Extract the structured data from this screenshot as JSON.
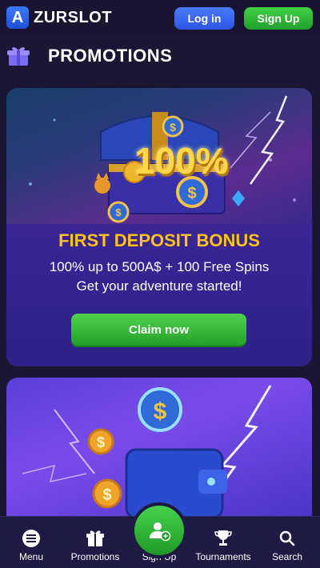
{
  "header": {
    "logo_letter": "A",
    "brand": "ZURSLOT",
    "login_label": "Log in",
    "signup_label": "Sign Up"
  },
  "page": {
    "title": "PROMOTIONS"
  },
  "promo_card": {
    "art_text": "100%",
    "title": "FIRST DEPOSIT BONUS",
    "line1": "100% up to 500A$ + 100 Free Spins",
    "line2": "Get your adventure started!",
    "cta_label": "Claim now"
  },
  "bottom_nav": {
    "items": [
      {
        "label": "Menu",
        "icon": "menu-icon"
      },
      {
        "label": "Promotions",
        "icon": "gift-icon"
      },
      {
        "label": "Sign Up",
        "icon": "add-user-icon"
      },
      {
        "label": "Tournaments",
        "icon": "trophy-icon"
      },
      {
        "label": "Search",
        "icon": "search-icon"
      }
    ]
  },
  "colors": {
    "background": "#1a1633",
    "accent_green": "#2fb535",
    "accent_blue": "#3a66f0",
    "bonus_gold": "#ffc21a",
    "card_purple": "#2e2288"
  }
}
